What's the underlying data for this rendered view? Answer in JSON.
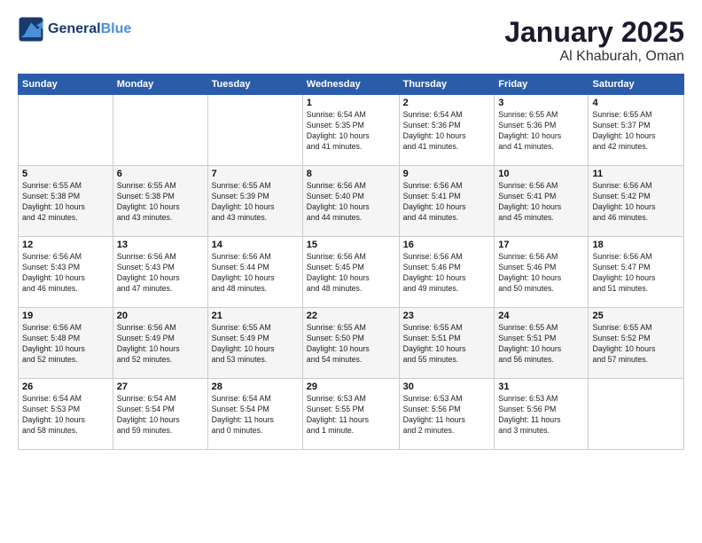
{
  "header": {
    "logo_line1": "General",
    "logo_line2": "Blue",
    "month": "January 2025",
    "location": "Al Khaburah, Oman"
  },
  "weekdays": [
    "Sunday",
    "Monday",
    "Tuesday",
    "Wednesday",
    "Thursday",
    "Friday",
    "Saturday"
  ],
  "weeks": [
    [
      {
        "day": "",
        "info": ""
      },
      {
        "day": "",
        "info": ""
      },
      {
        "day": "",
        "info": ""
      },
      {
        "day": "1",
        "info": "Sunrise: 6:54 AM\nSunset: 5:35 PM\nDaylight: 10 hours\nand 41 minutes."
      },
      {
        "day": "2",
        "info": "Sunrise: 6:54 AM\nSunset: 5:36 PM\nDaylight: 10 hours\nand 41 minutes."
      },
      {
        "day": "3",
        "info": "Sunrise: 6:55 AM\nSunset: 5:36 PM\nDaylight: 10 hours\nand 41 minutes."
      },
      {
        "day": "4",
        "info": "Sunrise: 6:55 AM\nSunset: 5:37 PM\nDaylight: 10 hours\nand 42 minutes."
      }
    ],
    [
      {
        "day": "5",
        "info": "Sunrise: 6:55 AM\nSunset: 5:38 PM\nDaylight: 10 hours\nand 42 minutes."
      },
      {
        "day": "6",
        "info": "Sunrise: 6:55 AM\nSunset: 5:38 PM\nDaylight: 10 hours\nand 43 minutes."
      },
      {
        "day": "7",
        "info": "Sunrise: 6:55 AM\nSunset: 5:39 PM\nDaylight: 10 hours\nand 43 minutes."
      },
      {
        "day": "8",
        "info": "Sunrise: 6:56 AM\nSunset: 5:40 PM\nDaylight: 10 hours\nand 44 minutes."
      },
      {
        "day": "9",
        "info": "Sunrise: 6:56 AM\nSunset: 5:41 PM\nDaylight: 10 hours\nand 44 minutes."
      },
      {
        "day": "10",
        "info": "Sunrise: 6:56 AM\nSunset: 5:41 PM\nDaylight: 10 hours\nand 45 minutes."
      },
      {
        "day": "11",
        "info": "Sunrise: 6:56 AM\nSunset: 5:42 PM\nDaylight: 10 hours\nand 46 minutes."
      }
    ],
    [
      {
        "day": "12",
        "info": "Sunrise: 6:56 AM\nSunset: 5:43 PM\nDaylight: 10 hours\nand 46 minutes."
      },
      {
        "day": "13",
        "info": "Sunrise: 6:56 AM\nSunset: 5:43 PM\nDaylight: 10 hours\nand 47 minutes."
      },
      {
        "day": "14",
        "info": "Sunrise: 6:56 AM\nSunset: 5:44 PM\nDaylight: 10 hours\nand 48 minutes."
      },
      {
        "day": "15",
        "info": "Sunrise: 6:56 AM\nSunset: 5:45 PM\nDaylight: 10 hours\nand 48 minutes."
      },
      {
        "day": "16",
        "info": "Sunrise: 6:56 AM\nSunset: 5:46 PM\nDaylight: 10 hours\nand 49 minutes."
      },
      {
        "day": "17",
        "info": "Sunrise: 6:56 AM\nSunset: 5:46 PM\nDaylight: 10 hours\nand 50 minutes."
      },
      {
        "day": "18",
        "info": "Sunrise: 6:56 AM\nSunset: 5:47 PM\nDaylight: 10 hours\nand 51 minutes."
      }
    ],
    [
      {
        "day": "19",
        "info": "Sunrise: 6:56 AM\nSunset: 5:48 PM\nDaylight: 10 hours\nand 52 minutes."
      },
      {
        "day": "20",
        "info": "Sunrise: 6:56 AM\nSunset: 5:49 PM\nDaylight: 10 hours\nand 52 minutes."
      },
      {
        "day": "21",
        "info": "Sunrise: 6:55 AM\nSunset: 5:49 PM\nDaylight: 10 hours\nand 53 minutes."
      },
      {
        "day": "22",
        "info": "Sunrise: 6:55 AM\nSunset: 5:50 PM\nDaylight: 10 hours\nand 54 minutes."
      },
      {
        "day": "23",
        "info": "Sunrise: 6:55 AM\nSunset: 5:51 PM\nDaylight: 10 hours\nand 55 minutes."
      },
      {
        "day": "24",
        "info": "Sunrise: 6:55 AM\nSunset: 5:51 PM\nDaylight: 10 hours\nand 56 minutes."
      },
      {
        "day": "25",
        "info": "Sunrise: 6:55 AM\nSunset: 5:52 PM\nDaylight: 10 hours\nand 57 minutes."
      }
    ],
    [
      {
        "day": "26",
        "info": "Sunrise: 6:54 AM\nSunset: 5:53 PM\nDaylight: 10 hours\nand 58 minutes."
      },
      {
        "day": "27",
        "info": "Sunrise: 6:54 AM\nSunset: 5:54 PM\nDaylight: 10 hours\nand 59 minutes."
      },
      {
        "day": "28",
        "info": "Sunrise: 6:54 AM\nSunset: 5:54 PM\nDaylight: 11 hours\nand 0 minutes."
      },
      {
        "day": "29",
        "info": "Sunrise: 6:53 AM\nSunset: 5:55 PM\nDaylight: 11 hours\nand 1 minute."
      },
      {
        "day": "30",
        "info": "Sunrise: 6:53 AM\nSunset: 5:56 PM\nDaylight: 11 hours\nand 2 minutes."
      },
      {
        "day": "31",
        "info": "Sunrise: 6:53 AM\nSunset: 5:56 PM\nDaylight: 11 hours\nand 3 minutes."
      },
      {
        "day": "",
        "info": ""
      }
    ]
  ]
}
